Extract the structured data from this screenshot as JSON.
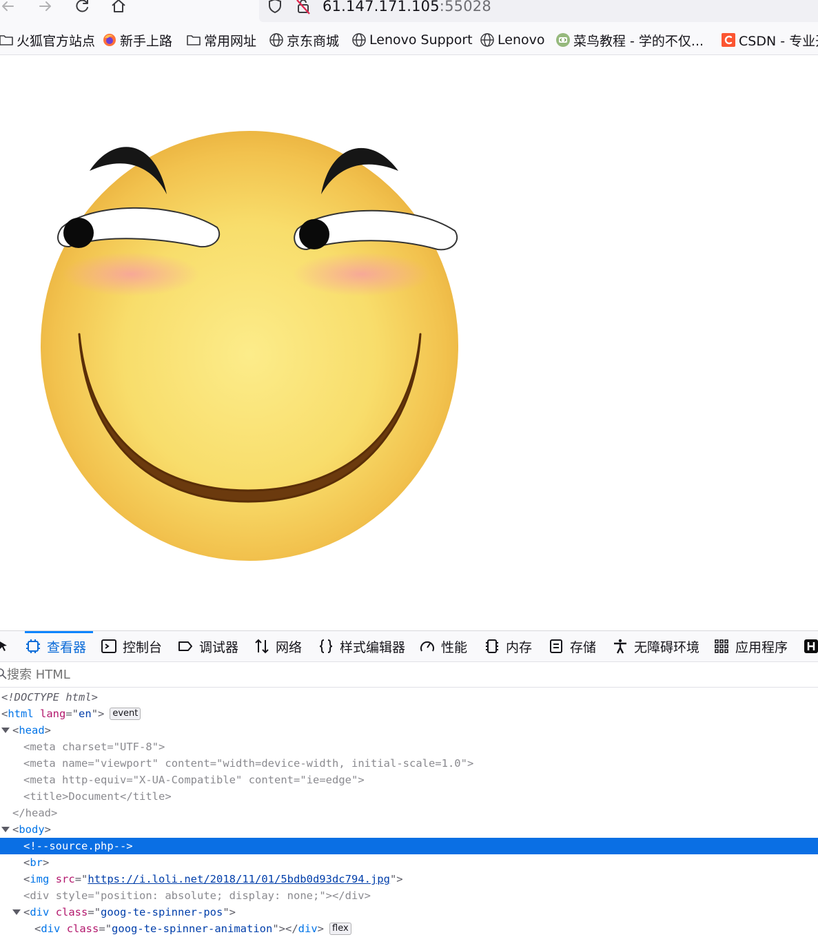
{
  "browser": {
    "url_host": "61.147.171.105",
    "url_port": ":55028"
  },
  "bookmarks": [
    {
      "label": "火狐官方站点",
      "icon": "folder-icon"
    },
    {
      "label": "新手上路",
      "icon": "firefox-icon"
    },
    {
      "label": "常用网址",
      "icon": "folder-icon"
    },
    {
      "label": "京东商城",
      "icon": "globe-icon"
    },
    {
      "label": "Lenovo Support",
      "icon": "globe-icon"
    },
    {
      "label": "Lenovo",
      "icon": "globe-icon"
    },
    {
      "label": "菜鸟教程 - 学的不仅...",
      "icon": "runoob-icon"
    },
    {
      "label": "CSDN - 专业开",
      "icon": "csdn-icon"
    }
  ],
  "devtools": {
    "tabs": [
      {
        "label": "查看器",
        "icon": "inspector-icon",
        "active": true
      },
      {
        "label": "控制台",
        "icon": "console-icon"
      },
      {
        "label": "调试器",
        "icon": "debugger-icon"
      },
      {
        "label": "网络",
        "icon": "network-icon"
      },
      {
        "label": "样式编辑器",
        "icon": "style-editor-icon"
      },
      {
        "label": "性能",
        "icon": "performance-icon"
      },
      {
        "label": "内存",
        "icon": "memory-icon"
      },
      {
        "label": "存储",
        "icon": "storage-icon"
      },
      {
        "label": "无障碍环境",
        "icon": "accessibility-icon"
      },
      {
        "label": "应用程序",
        "icon": "application-icon"
      }
    ],
    "search_placeholder": "搜索 HTML",
    "markup": {
      "doctype": "<!DOCTYPE html>",
      "html_tag": "html",
      "html_lang_attr": "lang",
      "html_lang_val": "en",
      "event_badge": "event",
      "head_tag": "head",
      "meta": "meta",
      "charset_attr": "charset",
      "charset_val": "UTF-8",
      "name_attr": "name",
      "viewport_val": "viewport",
      "content_attr": "content",
      "viewport_content_val": "width=device-width, initial-scale=1.0",
      "http_equiv_attr": "http-equiv",
      "http_equiv_val": "X-UA-Compatible",
      "ie_edge_val": "ie=edge",
      "title_tag": "title",
      "title_text": "Document",
      "body_tag": "body",
      "comment": "<!--source.php-->",
      "br_tag": "br",
      "img_tag": "img",
      "src_attr": "src",
      "img_src": "https://i.loli.net/2018/11/01/5bdb0d93dc794.jpg",
      "div_tag": "div",
      "style_attr": "style",
      "hidden_div_style": "position: absolute; display: none;",
      "class_attr": "class",
      "spinner_pos_class": "goog-te-spinner-pos",
      "spinner_anim_class": "goog-te-spinner-animation",
      "flex_badge": "flex"
    }
  }
}
